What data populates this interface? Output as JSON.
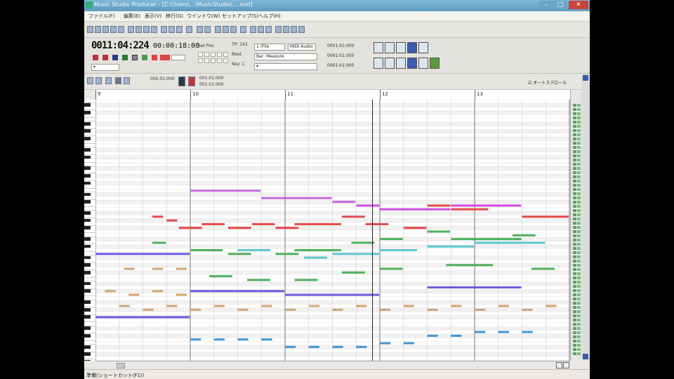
{
  "window": {
    "title": "Music Studio Producer - [C:\\Users\\...\\MusicStudio\\....mid]"
  },
  "menu": [
    "ファイル(F)",
    "編集(E)",
    "表示(V)",
    "移行(G)",
    "ウインドウ(W)",
    "セットアップ(S)",
    "ヘルプ(H)"
  ],
  "transport": {
    "position": "0011:04:224",
    "time": "00:00:18:08",
    "set_pos": "Set Pos.",
    "tempo": "TP: 142",
    "beat": "Beat",
    "key": "Key: C",
    "file": "1 (File",
    "port": "MIDI Audio",
    "measure": "Bar: Measure",
    "loc1": "0001:01:000",
    "loc2": "0001:01:000",
    "loc3": "0001:01:000"
  },
  "editor": {
    "pos1": "002:01:000",
    "pos2": "001:01:000",
    "pos3": "001:01:000",
    "autoscroll": "オートスクロール"
  },
  "ruler": {
    "measures": [
      "9",
      "10",
      "11",
      "12",
      "13"
    ]
  },
  "status": {
    "text": "準備(ショートカット(F1))"
  },
  "colors": {
    "purple": "#c46ae0",
    "magenta": "#d14ae0",
    "red": "#e24a48",
    "green": "#4fb05c",
    "cyan": "#5ec7cc",
    "tan": "#d2a473",
    "blue": "#6a5ce0",
    "lightblue": "#3f96d8"
  },
  "notes": [
    {
      "c": "purple",
      "m": 10.0,
      "len": 0.75,
      "row": 24
    },
    {
      "c": "purple",
      "m": 10.75,
      "len": 0.75,
      "row": 26
    },
    {
      "c": "purple",
      "m": 11.5,
      "len": 0.25,
      "row": 27
    },
    {
      "c": "magenta",
      "m": 11.75,
      "len": 0.25,
      "row": 28
    },
    {
      "c": "magenta",
      "m": 12.0,
      "len": 0.75,
      "row": 29
    },
    {
      "c": "magenta",
      "m": 12.75,
      "len": 0.75,
      "row": 28
    },
    {
      "c": "red",
      "m": 9.6,
      "len": 0.12,
      "row": 31
    },
    {
      "c": "red",
      "m": 9.75,
      "len": 0.12,
      "row": 32
    },
    {
      "c": "red",
      "m": 9.88,
      "len": 0.25,
      "row": 34
    },
    {
      "c": "red",
      "m": 10.12,
      "len": 0.25,
      "row": 33
    },
    {
      "c": "red",
      "m": 10.4,
      "len": 0.25,
      "row": 34
    },
    {
      "c": "red",
      "m": 10.65,
      "len": 0.25,
      "row": 33
    },
    {
      "c": "red",
      "m": 10.9,
      "len": 0.25,
      "row": 34
    },
    {
      "c": "red",
      "m": 11.1,
      "len": 0.5,
      "row": 33
    },
    {
      "c": "red",
      "m": 11.6,
      "len": 0.25,
      "row": 31
    },
    {
      "c": "red",
      "m": 11.85,
      "len": 0.25,
      "row": 33
    },
    {
      "c": "red",
      "m": 12.25,
      "len": 0.25,
      "row": 34
    },
    {
      "c": "red",
      "m": 12.5,
      "len": 0.25,
      "row": 28
    },
    {
      "c": "red",
      "m": 12.75,
      "len": 0.4,
      "row": 29
    },
    {
      "c": "red",
      "m": 13.5,
      "len": 0.5,
      "row": 31
    },
    {
      "c": "green",
      "m": 9.6,
      "len": 0.15,
      "row": 38
    },
    {
      "c": "green",
      "m": 10.0,
      "len": 0.35,
      "row": 40
    },
    {
      "c": "green",
      "m": 10.4,
      "len": 0.25,
      "row": 41
    },
    {
      "c": "green",
      "m": 10.9,
      "len": 0.25,
      "row": 41
    },
    {
      "c": "green",
      "m": 11.1,
      "len": 0.5,
      "row": 40
    },
    {
      "c": "green",
      "m": 11.7,
      "len": 0.25,
      "row": 38
    },
    {
      "c": "green",
      "m": 12.0,
      "len": 0.25,
      "row": 37
    },
    {
      "c": "green",
      "m": 12.5,
      "len": 0.25,
      "row": 35
    },
    {
      "c": "green",
      "m": 12.75,
      "len": 0.75,
      "row": 37
    },
    {
      "c": "green",
      "m": 13.4,
      "len": 0.25,
      "row": 36
    },
    {
      "c": "green",
      "m": 10.2,
      "len": 0.25,
      "row": 47
    },
    {
      "c": "green",
      "m": 10.6,
      "len": 0.25,
      "row": 48
    },
    {
      "c": "green",
      "m": 11.1,
      "len": 0.25,
      "row": 48
    },
    {
      "c": "green",
      "m": 11.6,
      "len": 0.25,
      "row": 46
    },
    {
      "c": "green",
      "m": 12.0,
      "len": 0.25,
      "row": 45
    },
    {
      "c": "green",
      "m": 12.7,
      "len": 0.5,
      "row": 44
    },
    {
      "c": "green",
      "m": 13.6,
      "len": 0.25,
      "row": 45
    },
    {
      "c": "cyan",
      "m": 10.5,
      "len": 0.35,
      "row": 40
    },
    {
      "c": "cyan",
      "m": 11.2,
      "len": 0.25,
      "row": 42
    },
    {
      "c": "cyan",
      "m": 11.5,
      "len": 0.5,
      "row": 41
    },
    {
      "c": "cyan",
      "m": 12.0,
      "len": 0.4,
      "row": 40
    },
    {
      "c": "cyan",
      "m": 12.5,
      "len": 0.5,
      "row": 39
    },
    {
      "c": "cyan",
      "m": 13.0,
      "len": 0.75,
      "row": 38
    },
    {
      "c": "blue",
      "m": 9.0,
      "len": 1.0,
      "row": 41
    },
    {
      "c": "blue",
      "m": 9.0,
      "len": 1.0,
      "row": 58
    },
    {
      "c": "blue",
      "m": 10.0,
      "len": 1.0,
      "row": 51
    },
    {
      "c": "blue",
      "m": 11.0,
      "len": 1.0,
      "row": 52
    },
    {
      "c": "blue",
      "m": 12.5,
      "len": 1.0,
      "row": 50
    },
    {
      "c": "tan",
      "m": 9.3,
      "len": 0.12,
      "row": 45
    },
    {
      "c": "tan",
      "m": 9.6,
      "len": 0.12,
      "row": 45
    },
    {
      "c": "tan",
      "m": 9.85,
      "len": 0.12,
      "row": 45
    },
    {
      "c": "tan",
      "m": 9.1,
      "len": 0.12,
      "row": 51
    },
    {
      "c": "tan",
      "m": 9.35,
      "len": 0.12,
      "row": 52
    },
    {
      "c": "tan",
      "m": 9.6,
      "len": 0.12,
      "row": 51
    },
    {
      "c": "tan",
      "m": 9.85,
      "len": 0.12,
      "row": 52
    },
    {
      "c": "tan",
      "m": 9.25,
      "len": 0.12,
      "row": 55
    },
    {
      "c": "tan",
      "m": 9.5,
      "len": 0.12,
      "row": 56
    },
    {
      "c": "tan",
      "m": 9.75,
      "len": 0.12,
      "row": 55
    },
    {
      "c": "tan",
      "m": 10.0,
      "len": 0.12,
      "row": 56
    },
    {
      "c": "tan",
      "m": 10.25,
      "len": 0.12,
      "row": 55
    },
    {
      "c": "tan",
      "m": 10.5,
      "len": 0.12,
      "row": 56
    },
    {
      "c": "tan",
      "m": 10.75,
      "len": 0.12,
      "row": 55
    },
    {
      "c": "tan",
      "m": 11.0,
      "len": 0.12,
      "row": 56
    },
    {
      "c": "tan",
      "m": 11.25,
      "len": 0.12,
      "row": 55
    },
    {
      "c": "tan",
      "m": 11.5,
      "len": 0.12,
      "row": 56
    },
    {
      "c": "tan",
      "m": 11.75,
      "len": 0.12,
      "row": 55
    },
    {
      "c": "tan",
      "m": 12.0,
      "len": 0.12,
      "row": 56
    },
    {
      "c": "tan",
      "m": 12.25,
      "len": 0.12,
      "row": 55
    },
    {
      "c": "tan",
      "m": 12.5,
      "len": 0.12,
      "row": 56
    },
    {
      "c": "tan",
      "m": 12.75,
      "len": 0.12,
      "row": 55
    },
    {
      "c": "tan",
      "m": 13.0,
      "len": 0.12,
      "row": 56
    },
    {
      "c": "tan",
      "m": 13.25,
      "len": 0.12,
      "row": 55
    },
    {
      "c": "tan",
      "m": 13.5,
      "len": 0.12,
      "row": 56
    },
    {
      "c": "tan",
      "m": 13.75,
      "len": 0.12,
      "row": 55
    },
    {
      "c": "lightblue",
      "m": 10.0,
      "len": 0.12,
      "row": 64
    },
    {
      "c": "lightblue",
      "m": 10.25,
      "len": 0.12,
      "row": 64
    },
    {
      "c": "lightblue",
      "m": 10.5,
      "len": 0.12,
      "row": 64
    },
    {
      "c": "lightblue",
      "m": 10.75,
      "len": 0.12,
      "row": 64
    },
    {
      "c": "lightblue",
      "m": 11.0,
      "len": 0.12,
      "row": 66
    },
    {
      "c": "lightblue",
      "m": 11.25,
      "len": 0.12,
      "row": 66
    },
    {
      "c": "lightblue",
      "m": 11.5,
      "len": 0.12,
      "row": 66
    },
    {
      "c": "lightblue",
      "m": 11.75,
      "len": 0.12,
      "row": 66
    },
    {
      "c": "lightblue",
      "m": 12.0,
      "len": 0.12,
      "row": 65
    },
    {
      "c": "lightblue",
      "m": 12.25,
      "len": 0.12,
      "row": 65
    },
    {
      "c": "lightblue",
      "m": 12.5,
      "len": 0.12,
      "row": 63
    },
    {
      "c": "lightblue",
      "m": 12.75,
      "len": 0.12,
      "row": 63
    },
    {
      "c": "lightblue",
      "m": 13.0,
      "len": 0.12,
      "row": 62
    },
    {
      "c": "lightblue",
      "m": 13.25,
      "len": 0.12,
      "row": 62
    },
    {
      "c": "lightblue",
      "m": 13.5,
      "len": 0.12,
      "row": 62
    }
  ]
}
